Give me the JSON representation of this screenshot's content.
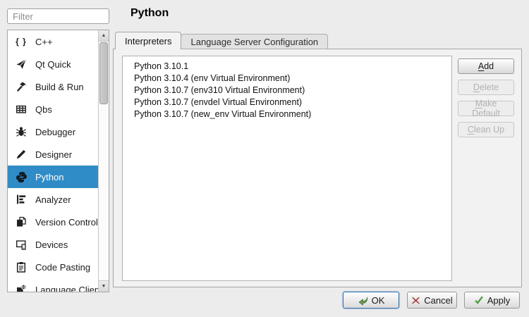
{
  "colors": {
    "accent": "#308cc6",
    "ok_green": "#6b9a57",
    "cancel_red": "#a33e3e",
    "apply_green": "#57a04b"
  },
  "filter": {
    "placeholder": "Filter",
    "value": ""
  },
  "icons": {
    "cpp_glyph": "{ }"
  },
  "sidebar": {
    "items": [
      {
        "label": "C++",
        "icon": "cpp-braces-icon",
        "selected": false
      },
      {
        "label": "Qt Quick",
        "icon": "paper-plane-icon",
        "selected": false
      },
      {
        "label": "Build & Run",
        "icon": "hammer-icon",
        "selected": false
      },
      {
        "label": "Qbs",
        "icon": "grid-table-icon",
        "selected": false
      },
      {
        "label": "Debugger",
        "icon": "bug-icon",
        "selected": false
      },
      {
        "label": "Designer",
        "icon": "pencil-icon",
        "selected": false
      },
      {
        "label": "Python",
        "icon": "python-logo-icon",
        "selected": true
      },
      {
        "label": "Analyzer",
        "icon": "analyzer-bars-icon",
        "selected": false
      },
      {
        "label": "Version Control",
        "icon": "documents-icon",
        "selected": false
      },
      {
        "label": "Devices",
        "icon": "devices-icon",
        "selected": false
      },
      {
        "label": "Code Pasting",
        "icon": "clipboard-icon",
        "selected": false
      },
      {
        "label": "Language Client",
        "icon": "language-client-icon",
        "selected": false
      }
    ]
  },
  "header": {
    "title": "Python"
  },
  "tabs": [
    {
      "label": "Interpreters",
      "active": true
    },
    {
      "label": "Language Server Configuration",
      "active": false
    }
  ],
  "interpreters": {
    "items": [
      "Python 3.10.1",
      "Python 3.10.4 (env Virtual Environment)",
      "Python 3.10.7 (env310 Virtual Environment)",
      "Python 3.10.7 (envdel Virtual Environment)",
      "Python 3.10.7 (new_env Virtual Environment)"
    ],
    "actions": [
      {
        "mnemonic": "A",
        "rest": "dd",
        "enabled": true
      },
      {
        "mnemonic": "D",
        "rest": "elete",
        "enabled": false
      },
      {
        "mnemonic": "M",
        "rest": "ake Default",
        "enabled": false
      },
      {
        "mnemonic": "C",
        "rest": "lean Up",
        "enabled": false
      }
    ]
  },
  "footer": {
    "ok": "OK",
    "cancel": "Cancel",
    "apply": "Apply"
  }
}
